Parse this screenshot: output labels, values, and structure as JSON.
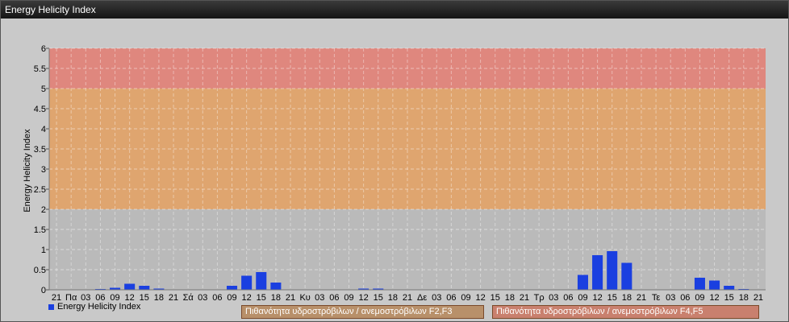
{
  "window": {
    "title": "Energy Helicity Index"
  },
  "legend": {
    "label": "Energy Helicity Index"
  },
  "band_labels": [
    "Πιθανότητα υδροστρόβιλων / ανεμοστρόβιλων F2,F3",
    "Πιθανότητα υδροστρόβιλων / ανεμοστρόβιλων F4,F5"
  ],
  "colors": {
    "bar": "#1a3fe0",
    "band_low": "#b9b9b9",
    "band_mid": "#e0a36a",
    "band_high": "#e0847a"
  },
  "chart_data": {
    "type": "bar",
    "ylabel": "Energy Helicity Index",
    "ylim": [
      0,
      6
    ],
    "yticks": [
      "0",
      "0.5",
      "1",
      "1.5",
      "2",
      "2.5",
      "3",
      "3.5",
      "4",
      "4.5",
      "5",
      "5.5",
      "6"
    ],
    "bands": [
      {
        "from": 0,
        "to": 2,
        "color": "#b9b9b9"
      },
      {
        "from": 2,
        "to": 5,
        "color": "#e0a36a"
      },
      {
        "from": 5,
        "to": 6,
        "color": "#e0847a"
      }
    ],
    "categories": [
      "21",
      "Πα",
      "03",
      "06",
      "09",
      "12",
      "15",
      "18",
      "21",
      "Σά",
      "03",
      "06",
      "09",
      "12",
      "15",
      "18",
      "21",
      "Κυ",
      "03",
      "06",
      "09",
      "12",
      "15",
      "18",
      "21",
      "Δε",
      "03",
      "06",
      "09",
      "12",
      "15",
      "18",
      "21",
      "Τρ",
      "03",
      "06",
      "09",
      "12",
      "15",
      "18",
      "21",
      "Τε",
      "03",
      "06",
      "09",
      "12",
      "15",
      "18",
      "21"
    ],
    "series": [
      {
        "name": "Energy Helicity Index",
        "values": [
          0.01,
          0.01,
          0.01,
          0.02,
          0.05,
          0.15,
          0.1,
          0.03,
          0.01,
          0.01,
          0.01,
          0.01,
          0.1,
          0.35,
          0.44,
          0.18,
          0.01,
          0.01,
          0.01,
          0.01,
          0.01,
          0.03,
          0.03,
          0.01,
          0.01,
          0.01,
          0.01,
          0.01,
          0.01,
          0.01,
          0.01,
          0.01,
          0.01,
          0.01,
          0.01,
          0.01,
          0.37,
          0.86,
          0.96,
          0.67,
          0.01,
          0.01,
          0.01,
          0.01,
          0.3,
          0.23,
          0.1,
          0.02,
          0.01
        ]
      }
    ],
    "grid": true
  }
}
